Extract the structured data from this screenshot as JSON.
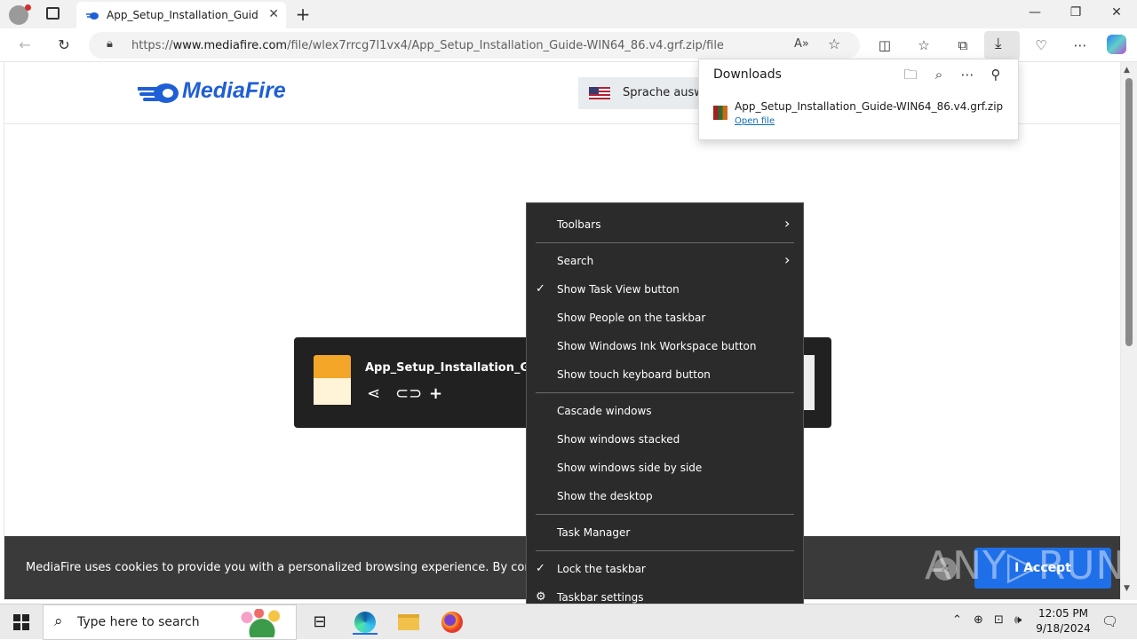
{
  "browser": {
    "tab_title": "App_Setup_Installation_Guide-W",
    "url_prefix": "https://",
    "url_domain": "www.mediafire.com",
    "url_path": "/file/wlex7rrcg7l1vx4/App_Setup_Installation_Guide-WIN64_86.v4.grf.zip/file"
  },
  "page": {
    "logo": "MediaFire",
    "language_label": "Sprache auswä",
    "file_name": "App_Setup_Installation_Guide-W",
    "cookie_text": "MediaFire uses cookies to provide you with a personalized browsing experience. By continuing to",
    "accept_label": "I Accept",
    "watermark": "ANY▷RUN"
  },
  "downloads": {
    "title": "Downloads",
    "file_name": "App_Setup_Installation_Guide-WIN64_86.v4.grf.zip",
    "open_label": "Open file"
  },
  "context_menu": {
    "items": [
      {
        "label": "Toolbars",
        "submenu": true,
        "checked": false
      },
      {
        "label": "Search",
        "submenu": true,
        "checked": false
      },
      {
        "label": "Show Task View button",
        "submenu": false,
        "checked": true
      },
      {
        "label": "Show People on the taskbar",
        "submenu": false,
        "checked": false
      },
      {
        "label": "Show Windows Ink Workspace button",
        "submenu": false,
        "checked": false
      },
      {
        "label": "Show touch keyboard button",
        "submenu": false,
        "checked": false
      },
      {
        "label": "Cascade windows",
        "submenu": false,
        "checked": false
      },
      {
        "label": "Show windows stacked",
        "submenu": false,
        "checked": false
      },
      {
        "label": "Show windows side by side",
        "submenu": false,
        "checked": false
      },
      {
        "label": "Show the desktop",
        "submenu": false,
        "checked": false
      },
      {
        "label": "Task Manager",
        "submenu": false,
        "checked": false
      },
      {
        "label": "Lock the taskbar",
        "submenu": false,
        "checked": true
      },
      {
        "label": "Taskbar settings",
        "submenu": false,
        "checked": false
      }
    ]
  },
  "taskbar": {
    "search_placeholder": "Type here to search",
    "time": "12:05 PM",
    "date": "9/18/2024"
  },
  "colors": {
    "accent": "#1f6fe8",
    "menu_bg": "#2b2b2b",
    "brand": "#1f5fd6"
  }
}
